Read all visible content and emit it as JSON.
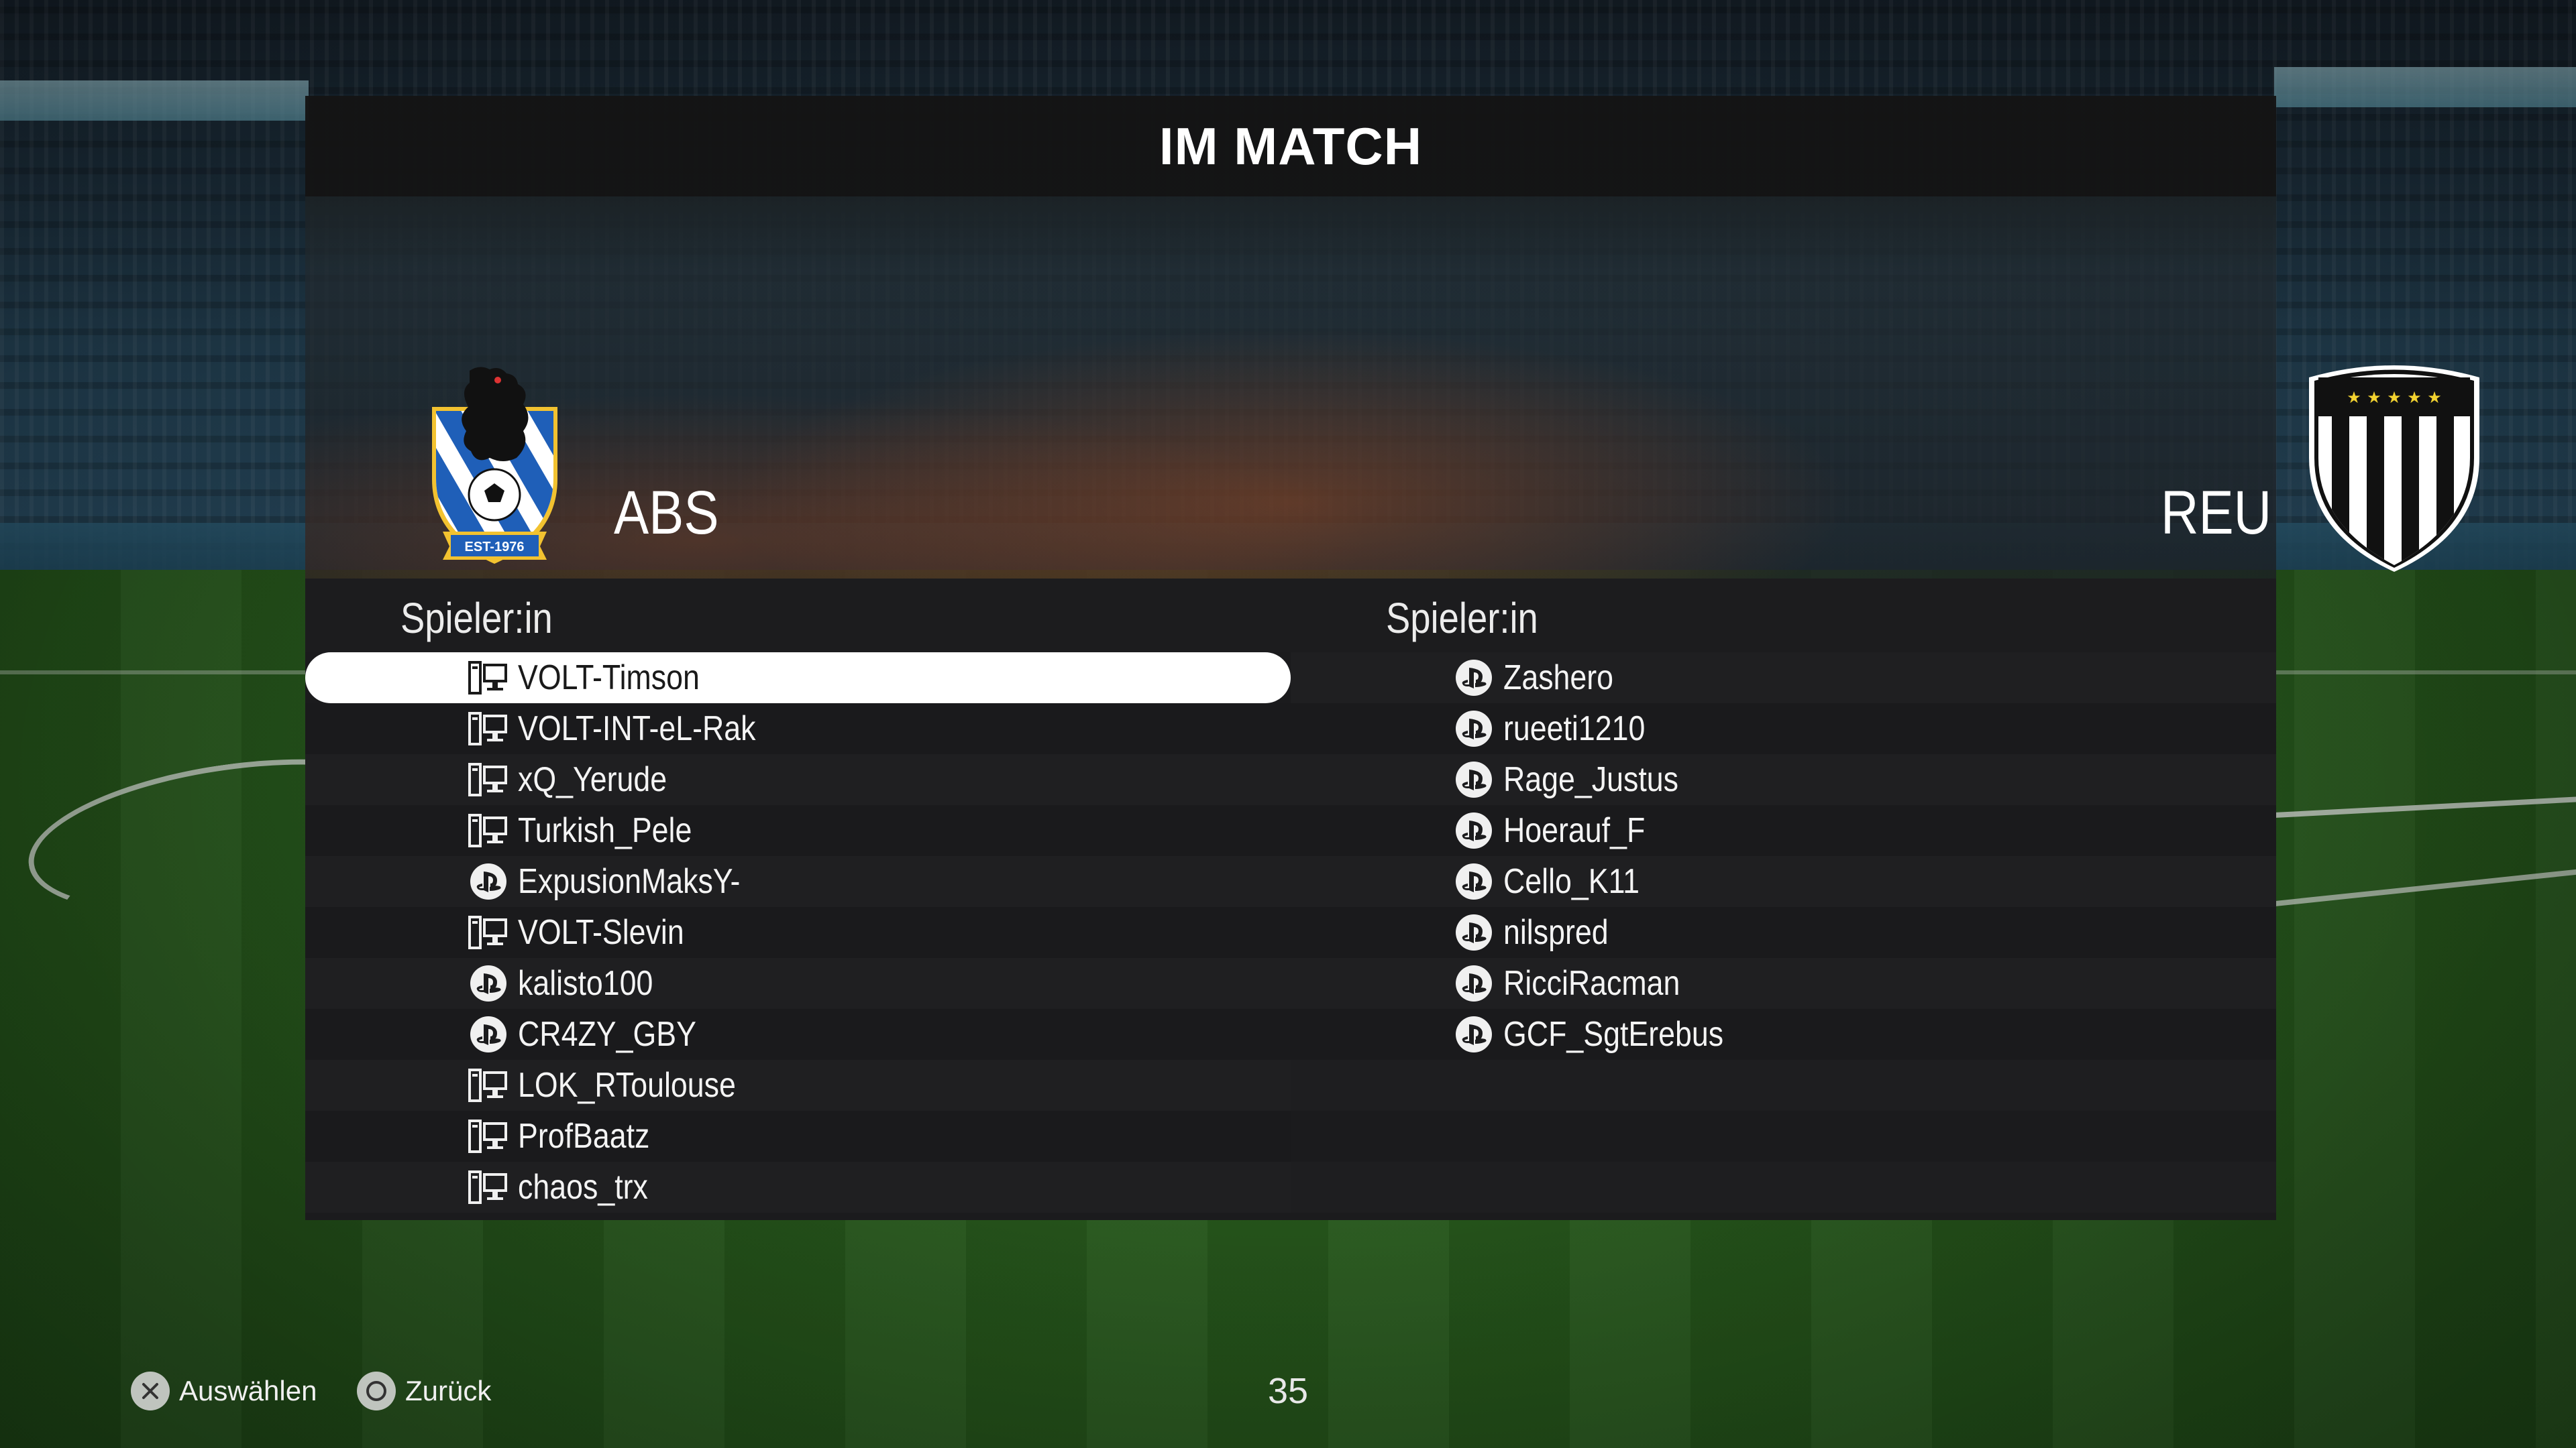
{
  "screen": {
    "title": "IM MATCH"
  },
  "home": {
    "code": "ABS",
    "column_label": "Spieler:in",
    "crest_icon": "abs-bear-crest",
    "crest_year": "EST-1976",
    "players": [
      {
        "name": "VOLT-Timson",
        "platform": "pc",
        "selected": true
      },
      {
        "name": "VOLT-INT-eL-Rak",
        "platform": "pc"
      },
      {
        "name": "xQ_Yerude",
        "platform": "pc"
      },
      {
        "name": "Turkish_Pele",
        "platform": "pc"
      },
      {
        "name": "ExpusionMaksY-",
        "platform": "playstation"
      },
      {
        "name": "VOLT-Slevin",
        "platform": "pc"
      },
      {
        "name": "kalisto100",
        "platform": "playstation"
      },
      {
        "name": "CR4ZY_GBY",
        "platform": "playstation"
      },
      {
        "name": "LOK_RToulouse",
        "platform": "pc"
      },
      {
        "name": "ProfBaatz",
        "platform": "pc"
      },
      {
        "name": "chaos_trx",
        "platform": "pc"
      }
    ]
  },
  "away": {
    "code": "REU",
    "column_label": "Spieler:in",
    "crest_icon": "reu-striped-shield-crest",
    "players": [
      {
        "name": "Zashero",
        "platform": "playstation"
      },
      {
        "name": "rueeti1210",
        "platform": "playstation"
      },
      {
        "name": "Rage_Justus",
        "platform": "playstation"
      },
      {
        "name": "Hoerauf_F",
        "platform": "playstation"
      },
      {
        "name": "Cello_K11",
        "platform": "playstation"
      },
      {
        "name": "nilspred",
        "platform": "playstation"
      },
      {
        "name": "RicciRacman",
        "platform": "playstation"
      },
      {
        "name": "GCF_SgtErebus",
        "platform": "playstation"
      }
    ]
  },
  "footer": {
    "select_label": "Auswählen",
    "select_icon": "cross-button-icon",
    "back_label": "Zurück",
    "back_icon": "circle-button-icon",
    "timer": "35"
  },
  "colors": {
    "panel_bg": "#1b1b1d",
    "selected_row": "#ffffff",
    "text": "#ffffff"
  }
}
